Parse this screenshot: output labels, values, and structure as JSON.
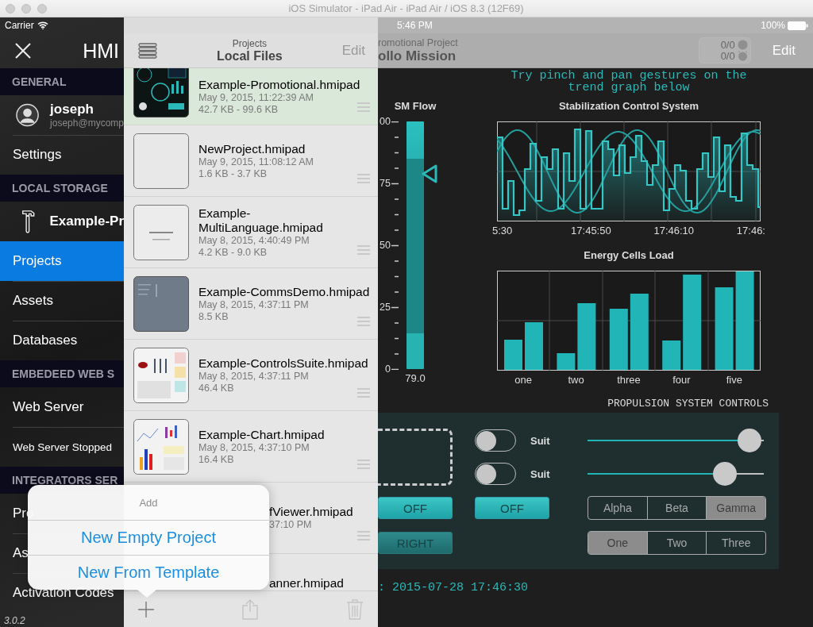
{
  "window": {
    "title": "iOS Simulator - iPad Air - iPad Air / iOS 8.3 (12F69)"
  },
  "sidebar": {
    "carrier": "Carrier",
    "title": "HMI",
    "sections": [
      {
        "header": "GENERAL",
        "items": [
          {
            "kind": "user",
            "label": "joseph",
            "subtitle": "joseph@mycomp",
            "selected": false
          },
          {
            "kind": "item",
            "label": "Settings",
            "selected": false
          }
        ]
      },
      {
        "header": "LOCAL STORAGE",
        "items": [
          {
            "kind": "project",
            "label": "Example-Pr",
            "selected": false
          },
          {
            "kind": "item",
            "label": "Projects",
            "selected": true
          },
          {
            "kind": "item",
            "label": "Assets",
            "selected": false
          },
          {
            "kind": "item",
            "label": "Databases",
            "selected": false
          }
        ]
      },
      {
        "header": "EMBEDEED WEB S",
        "items": [
          {
            "kind": "item",
            "label": "Web Server",
            "selected": false
          },
          {
            "kind": "status",
            "label": "Web Server Stopped",
            "selected": false
          }
        ]
      },
      {
        "header": "INTEGRATORS SER",
        "items": [
          {
            "kind": "item",
            "label": "Pro",
            "selected": false
          },
          {
            "kind": "item",
            "label": "As",
            "selected": false
          },
          {
            "kind": "item",
            "label": "Activation Codes",
            "selected": false
          }
        ]
      }
    ],
    "version": "3.0.2"
  },
  "files_panel": {
    "subtitle": "Projects",
    "title": "Local Files",
    "edit": "Edit",
    "files": [
      {
        "kind": "full",
        "thumbnail": {
          "kind": "dashboard"
        },
        "name": "Example-Promotional.hmipad",
        "date": "May 9, 2015, 11:22:39 AM",
        "size": "42.7 KB - 99.6 KB",
        "selected": true
      },
      {
        "kind": "full",
        "thumbnail": {
          "kind": "blank"
        },
        "name": "NewProject.hmipad",
        "date": "May 9, 2015, 11:08:12 AM",
        "size": "1.6 KB - 3.7 KB",
        "selected": false
      },
      {
        "kind": "full",
        "thumbnail": {
          "kind": "text"
        },
        "name": "Example-MultiLanguage.hmipad",
        "date": "May 8, 2015, 4:40:49 PM",
        "size": "4.2 KB - 9.0 KB",
        "selected": false
      },
      {
        "kind": "full",
        "thumbnail": {
          "kind": "grey"
        },
        "name": "Example-CommsDemo.hmipad",
        "date": "May 8, 2015, 4:37:11 PM",
        "size": "8.5 KB",
        "selected": false
      },
      {
        "kind": "full",
        "thumbnail": {
          "kind": "controls"
        },
        "name": "Example-ControlsSuite.hmipad",
        "date": "May 8, 2015, 4:37:11 PM",
        "size": "46.4 KB",
        "selected": false
      },
      {
        "kind": "full",
        "thumbnail": {
          "kind": "charts"
        },
        "name": "Example-Chart.hmipad",
        "date": "May 8, 2015, 4:37:10 PM",
        "size": "16.4 KB",
        "selected": false
      },
      {
        "kind": "partial",
        "name": "fViewer.hmipad",
        "date": "37:10 PM",
        "selected": false
      },
      {
        "kind": "partial",
        "name": "anner.hmipad",
        "selected": false
      }
    ]
  },
  "popover": {
    "title": "Add",
    "actions": [
      {
        "label": "New Empty Project"
      },
      {
        "label": "New From Template"
      }
    ]
  },
  "dashboard": {
    "time": "5:46 PM",
    "battery": "100%",
    "subtitle": "romotional Project",
    "title": "ollo Mission",
    "counters": [
      "0/0",
      "0/0"
    ],
    "edit": "Edit",
    "hint": "Try pinch and pan gestures on the trend graph below",
    "gauge": {
      "title": "SM Flow",
      "ticks": [
        "00",
        "75",
        "50",
        "25",
        "0"
      ],
      "reading": "79.0",
      "level": 0.79
    },
    "trend": {
      "title": "Stabilization Control System",
      "x_labels": [
        "5:30",
        "17:45:50",
        "17:46:10",
        "17:46:"
      ]
    },
    "bars": {
      "title": "Energy Cells Load",
      "categories": [
        "one",
        "two",
        "three",
        "four",
        "five"
      ]
    },
    "propulsion": {
      "title": "PROPULSION SYSTEM CONTROLS",
      "switches": [
        {
          "label": "Suit",
          "on": false
        },
        {
          "label": "Suit",
          "on": false
        }
      ],
      "sliders": [
        {
          "level": 0.92
        },
        {
          "level": 0.78
        }
      ],
      "buttons": [
        {
          "label": "OFF",
          "kind": "bright"
        },
        {
          "label": "OFF",
          "kind": "bright"
        },
        {
          "label": "RIGHT",
          "kind": "dim"
        }
      ],
      "segmented_controls": [
        {
          "options": [
            {
              "label": "Alpha",
              "selected": false
            },
            {
              "label": "Beta",
              "selected": false
            },
            {
              "label": "Gamma",
              "selected": true
            }
          ]
        },
        {
          "options": [
            {
              "label": "One",
              "selected": true
            },
            {
              "label": "Two",
              "selected": false
            },
            {
              "label": "Three",
              "selected": false
            }
          ]
        }
      ]
    },
    "timestamp": ": 2015-07-28 17:46:30"
  }
}
